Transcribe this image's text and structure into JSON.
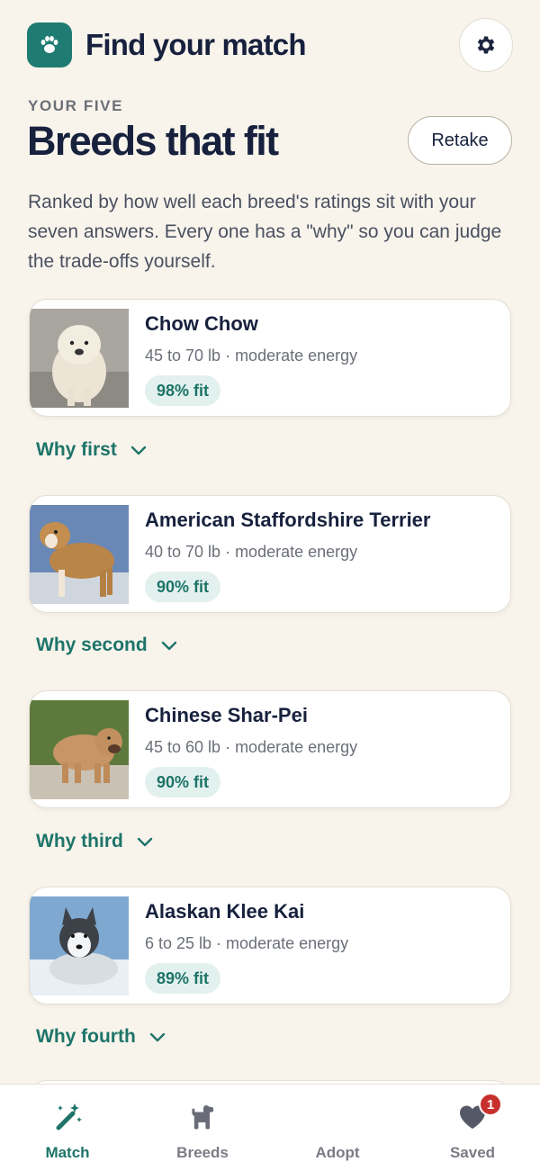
{
  "header": {
    "app_title": "Find your match"
  },
  "results": {
    "eyebrow": "YOUR FIVE",
    "title": "Breeds that fit",
    "retake_label": "Retake",
    "intro": "Ranked by how well each breed's ratings sit with your seven answers. Every one has a \"why\" so you can judge the trade-offs yourself.",
    "breeds": [
      {
        "name": "Chow Chow",
        "meta": "45 to 70 lb · moderate energy",
        "fit": "98% fit",
        "why": "Why first"
      },
      {
        "name": "American Staffordshire Terrier",
        "meta": "40 to 70 lb · moderate energy",
        "fit": "90% fit",
        "why": "Why second"
      },
      {
        "name": "Chinese Shar-Pei",
        "meta": "45 to 60 lb · moderate energy",
        "fit": "90% fit",
        "why": "Why third"
      },
      {
        "name": "Alaskan Klee Kai",
        "meta": "6 to 25 lb · moderate energy",
        "fit": "89% fit",
        "why": "Why fourth"
      }
    ]
  },
  "tabs": [
    {
      "label": "Match",
      "icon": "magic-wand-icon",
      "active": true
    },
    {
      "label": "Breeds",
      "icon": "dog-icon"
    },
    {
      "label": "Adopt",
      "icon": ""
    },
    {
      "label": "Saved",
      "icon": "heart-icon",
      "badge": "1"
    }
  ],
  "colors": {
    "accent": "#1e7469",
    "background": "#f8f4ec",
    "badge": "#c7302c"
  }
}
